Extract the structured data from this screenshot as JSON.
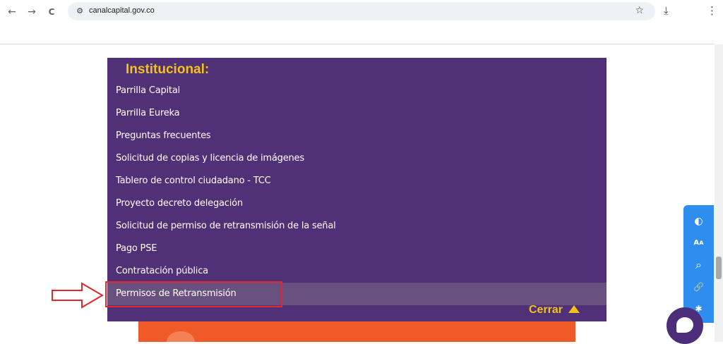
{
  "browser": {
    "url": "canalcapital.gov.co",
    "back_icon": "←",
    "forward_icon": "→",
    "reload_icon": "C",
    "site_info_icon": "⚙",
    "star_icon": "☆",
    "download_icon": "⤓",
    "menu_icon": "⋮"
  },
  "menu": {
    "title": "Institucional:",
    "items": [
      {
        "label": "Parrilla Capital"
      },
      {
        "label": "Parrilla Eureka"
      },
      {
        "label": "Preguntas frecuentes"
      },
      {
        "label": "Solicitud de copias y licencia de imágenes"
      },
      {
        "label": "Tablero de control ciudadano - TCC"
      },
      {
        "label": "Proyecto decreto delegación"
      },
      {
        "label": "Solicitud de permiso de retransmisión de la señal"
      },
      {
        "label": "Pago PSE"
      },
      {
        "label": "Contratación pública"
      },
      {
        "label": "Permisos de Retransmisión"
      }
    ],
    "close_label": "Cerrar"
  },
  "accessibility_toolbar": {
    "buttons": [
      {
        "icon": "contrast-icon",
        "glyph": "◐"
      },
      {
        "icon": "font-size-icon",
        "glyph": "Aᴀ"
      },
      {
        "icon": "zoom-icon",
        "glyph": "⌕"
      },
      {
        "icon": "link-icon",
        "glyph": "🔗"
      },
      {
        "icon": "accessibility-icon",
        "glyph": "✱"
      }
    ]
  },
  "colors": {
    "panel": "#503178",
    "accent_yellow": "#f3c11b",
    "highlight_red": "#e0282e",
    "toolbar_blue": "#2d8ef0",
    "banner_orange": "#f05a28"
  }
}
